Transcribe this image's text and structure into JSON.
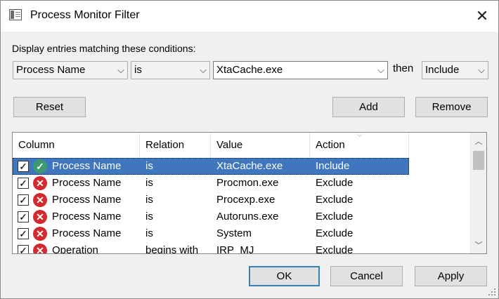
{
  "window": {
    "title": "Process Monitor Filter"
  },
  "prompt": "Display entries matching these conditions:",
  "filter": {
    "column_value": "Process Name",
    "relation_value": "is",
    "value_text": "XtaCache.exe",
    "then_label": "then",
    "action_value": "Include"
  },
  "buttons": {
    "reset": "Reset",
    "add": "Add",
    "remove": "Remove",
    "ok": "OK",
    "cancel": "Cancel",
    "apply": "Apply"
  },
  "table": {
    "headers": {
      "column": "Column",
      "relation": "Relation",
      "value": "Value",
      "action": "Action"
    },
    "rows": [
      {
        "column": "Process Name",
        "relation": "is",
        "value": "XtaCache.exe",
        "action": "Include",
        "checked": true,
        "icon": "include-icon",
        "selected": true
      },
      {
        "column": "Process Name",
        "relation": "is",
        "value": "Procmon.exe",
        "action": "Exclude",
        "checked": true,
        "icon": "exclude-icon",
        "selected": false
      },
      {
        "column": "Process Name",
        "relation": "is",
        "value": "Procexp.exe",
        "action": "Exclude",
        "checked": true,
        "icon": "exclude-icon",
        "selected": false
      },
      {
        "column": "Process Name",
        "relation": "is",
        "value": "Autoruns.exe",
        "action": "Exclude",
        "checked": true,
        "icon": "exclude-icon",
        "selected": false
      },
      {
        "column": "Process Name",
        "relation": "is",
        "value": "System",
        "action": "Exclude",
        "checked": true,
        "icon": "exclude-icon",
        "selected": false
      },
      {
        "column": "Operation",
        "relation": "begins with",
        "value": "IRP_MJ_",
        "action": "Exclude",
        "checked": true,
        "icon": "exclude-icon",
        "selected": false
      }
    ]
  },
  "colors": {
    "selection": "#3f76bd",
    "include_icon": "#3d9a6e",
    "exclude_icon": "#d3282e",
    "default_button_border": "#3c7fb1"
  }
}
